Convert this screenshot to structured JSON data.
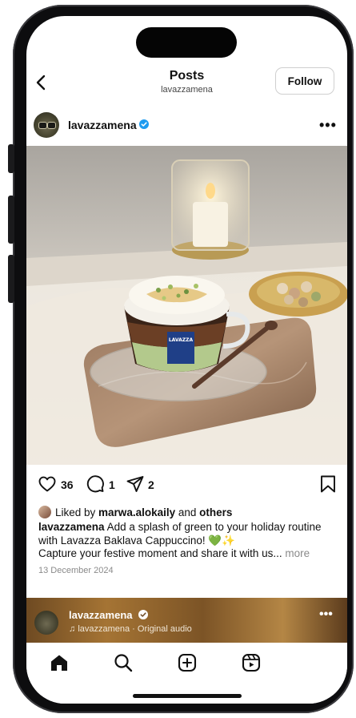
{
  "header": {
    "title": "Posts",
    "subtitle": "lavazzamena",
    "follow_label": "Follow",
    "back_icon": "chevron-left-icon"
  },
  "post": {
    "username": "lavazzamena",
    "verified": true,
    "more_icon": "more-horizontal-icon",
    "likes_count": "36",
    "comments_count": "1",
    "shares_count": "2",
    "liked_by_prefix": "Liked by ",
    "liked_by_user": "marwa.alokaily",
    "liked_by_mid": " and ",
    "liked_by_others": "others",
    "caption_text": " Add a splash of green to your holiday routine with Lavazza  Baklava Cappuccino! 💚✨",
    "caption_line2": "Capture your festive moment and share it with us...",
    "more_label": " more",
    "date": "13 December 2024",
    "cup_brand": "LAVAZZA"
  },
  "next_post": {
    "username": "lavazzamena",
    "audio": "lavazzamena · Original audio"
  },
  "navbar": {
    "items": [
      "home-icon",
      "search-icon",
      "create-icon",
      "reels-icon"
    ]
  },
  "colors": {
    "accent_blue": "#1d9bf0",
    "text": "#111111",
    "muted": "#8a8a8a"
  }
}
